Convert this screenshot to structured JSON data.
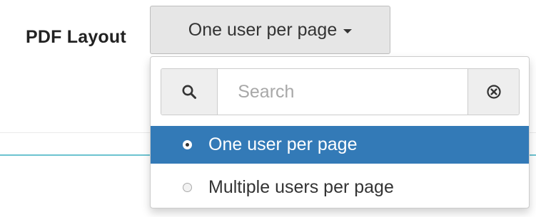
{
  "field": {
    "label": "PDF Layout"
  },
  "dropdown": {
    "selected_label": "One user per page",
    "is_open": true
  },
  "search": {
    "value": "",
    "placeholder": "Search"
  },
  "options": [
    {
      "label": "One user per page",
      "checked": true,
      "highlighted": true
    },
    {
      "label": "Multiple users per page",
      "checked": false,
      "highlighted": false
    }
  ],
  "colors": {
    "highlight": "#337ab7",
    "teal_divider": "#6cc3d0",
    "toggle_bg": "#e6e6e6"
  },
  "icons": {
    "search_addon": "search-icon",
    "clear_addon": "clear-circle-icon",
    "toggle_caret": "caret-down-icon"
  }
}
